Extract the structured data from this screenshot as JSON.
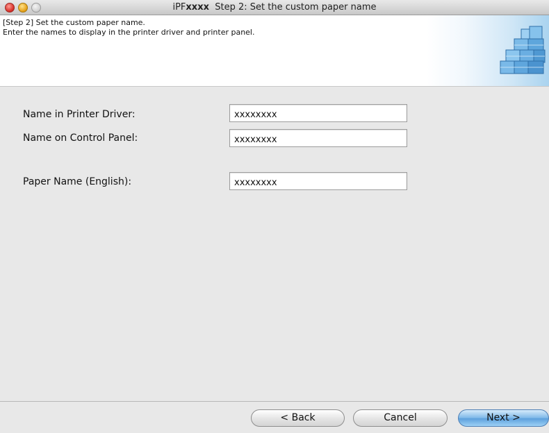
{
  "window": {
    "title_prefix": "iPF",
    "title_app": "xxxx",
    "title_rest": "  Step 2: Set the custom paper name"
  },
  "header": {
    "line1": "[Step 2] Set the custom paper name.",
    "line2": "Enter the names to display in the printer driver and printer panel."
  },
  "form": {
    "driver_name_label": "Name in Printer Driver:",
    "driver_name_value": "xxxxxxxx",
    "panel_name_label": "Name on Control Panel:",
    "panel_name_value": "xxxxxxxx",
    "english_name_label": "Paper Name (English):",
    "english_name_value": "xxxxxxxx"
  },
  "buttons": {
    "back": "< Back",
    "cancel": "Cancel",
    "next": "Next >"
  },
  "colors": {
    "window_bg": "#e8e8e8",
    "default_button": "#7db8e8"
  }
}
